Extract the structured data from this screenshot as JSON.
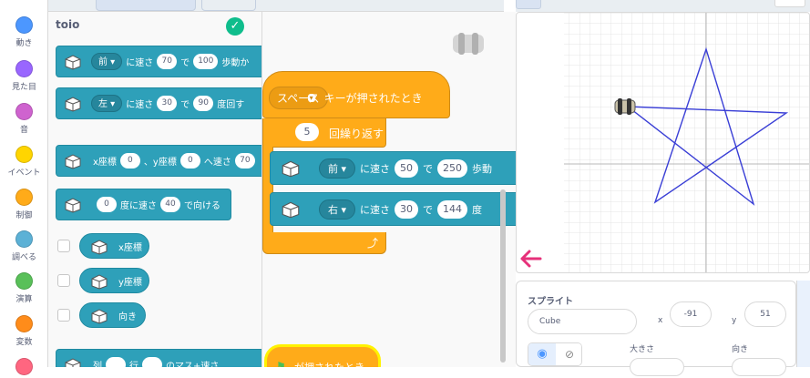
{
  "categories": [
    {
      "label": "動き",
      "color": "#4c97ff"
    },
    {
      "label": "見た目",
      "color": "#9966ff"
    },
    {
      "label": "音",
      "color": "#cf63cf"
    },
    {
      "label": "イベント",
      "color": "#ffd500"
    },
    {
      "label": "制御",
      "color": "#ffab19"
    },
    {
      "label": "調べる",
      "color": "#5cb1d6"
    },
    {
      "label": "演算",
      "color": "#59c059"
    },
    {
      "label": "変数",
      "color": "#ff8c1a"
    }
  ],
  "palette": {
    "title": "toio",
    "move": {
      "direction": "前",
      "text1": "に速さ",
      "speed": "70",
      "text2": "で",
      "amount": "100",
      "text3": "歩動か"
    },
    "turn": {
      "direction": "左",
      "text1": "に速さ",
      "speed": "30",
      "text2": "で",
      "amount": "90",
      "text3": "度回す"
    },
    "goto_xy": {
      "text1": "x座標",
      "x": "0",
      "text2": "、y座標",
      "y": "0",
      "text3": "へ速さ",
      "speed": "70"
    },
    "point": {
      "deg": "0",
      "text1": "度に速さ",
      "speed": "40",
      "text2": "で向ける"
    },
    "reporters": [
      "x座標",
      "y座標",
      "向き"
    ],
    "partial": {
      "text1": "列",
      "text2": "行",
      "text3": "のマス+速さ"
    }
  },
  "script": {
    "hat": {
      "key": "スペース",
      "text": "キーが押されたとき"
    },
    "repeat": {
      "count": "5",
      "text": "回繰り返す"
    },
    "move": {
      "direction": "前",
      "text1": "に速さ",
      "speed": "50",
      "text2": "で",
      "amount": "250",
      "text3": "歩動"
    },
    "turn": {
      "direction": "右",
      "text1": "に速さ",
      "speed": "30",
      "text2": "で",
      "amount": "144",
      "text3": "度"
    },
    "flag_hat": {
      "text": "が押されたとき"
    }
  },
  "sprite_panel": {
    "title": "スプライト",
    "name": "Cube",
    "x_label": "x",
    "x_value": "-91",
    "y_label": "y",
    "y_value": "51",
    "size_label": "大きさ",
    "direction_label": "向き"
  },
  "colors": {
    "motion_block": "#2ea0b9",
    "control_block": "#ffab19",
    "star_line": "#3a3fd6",
    "arrow": "#e6317a"
  }
}
